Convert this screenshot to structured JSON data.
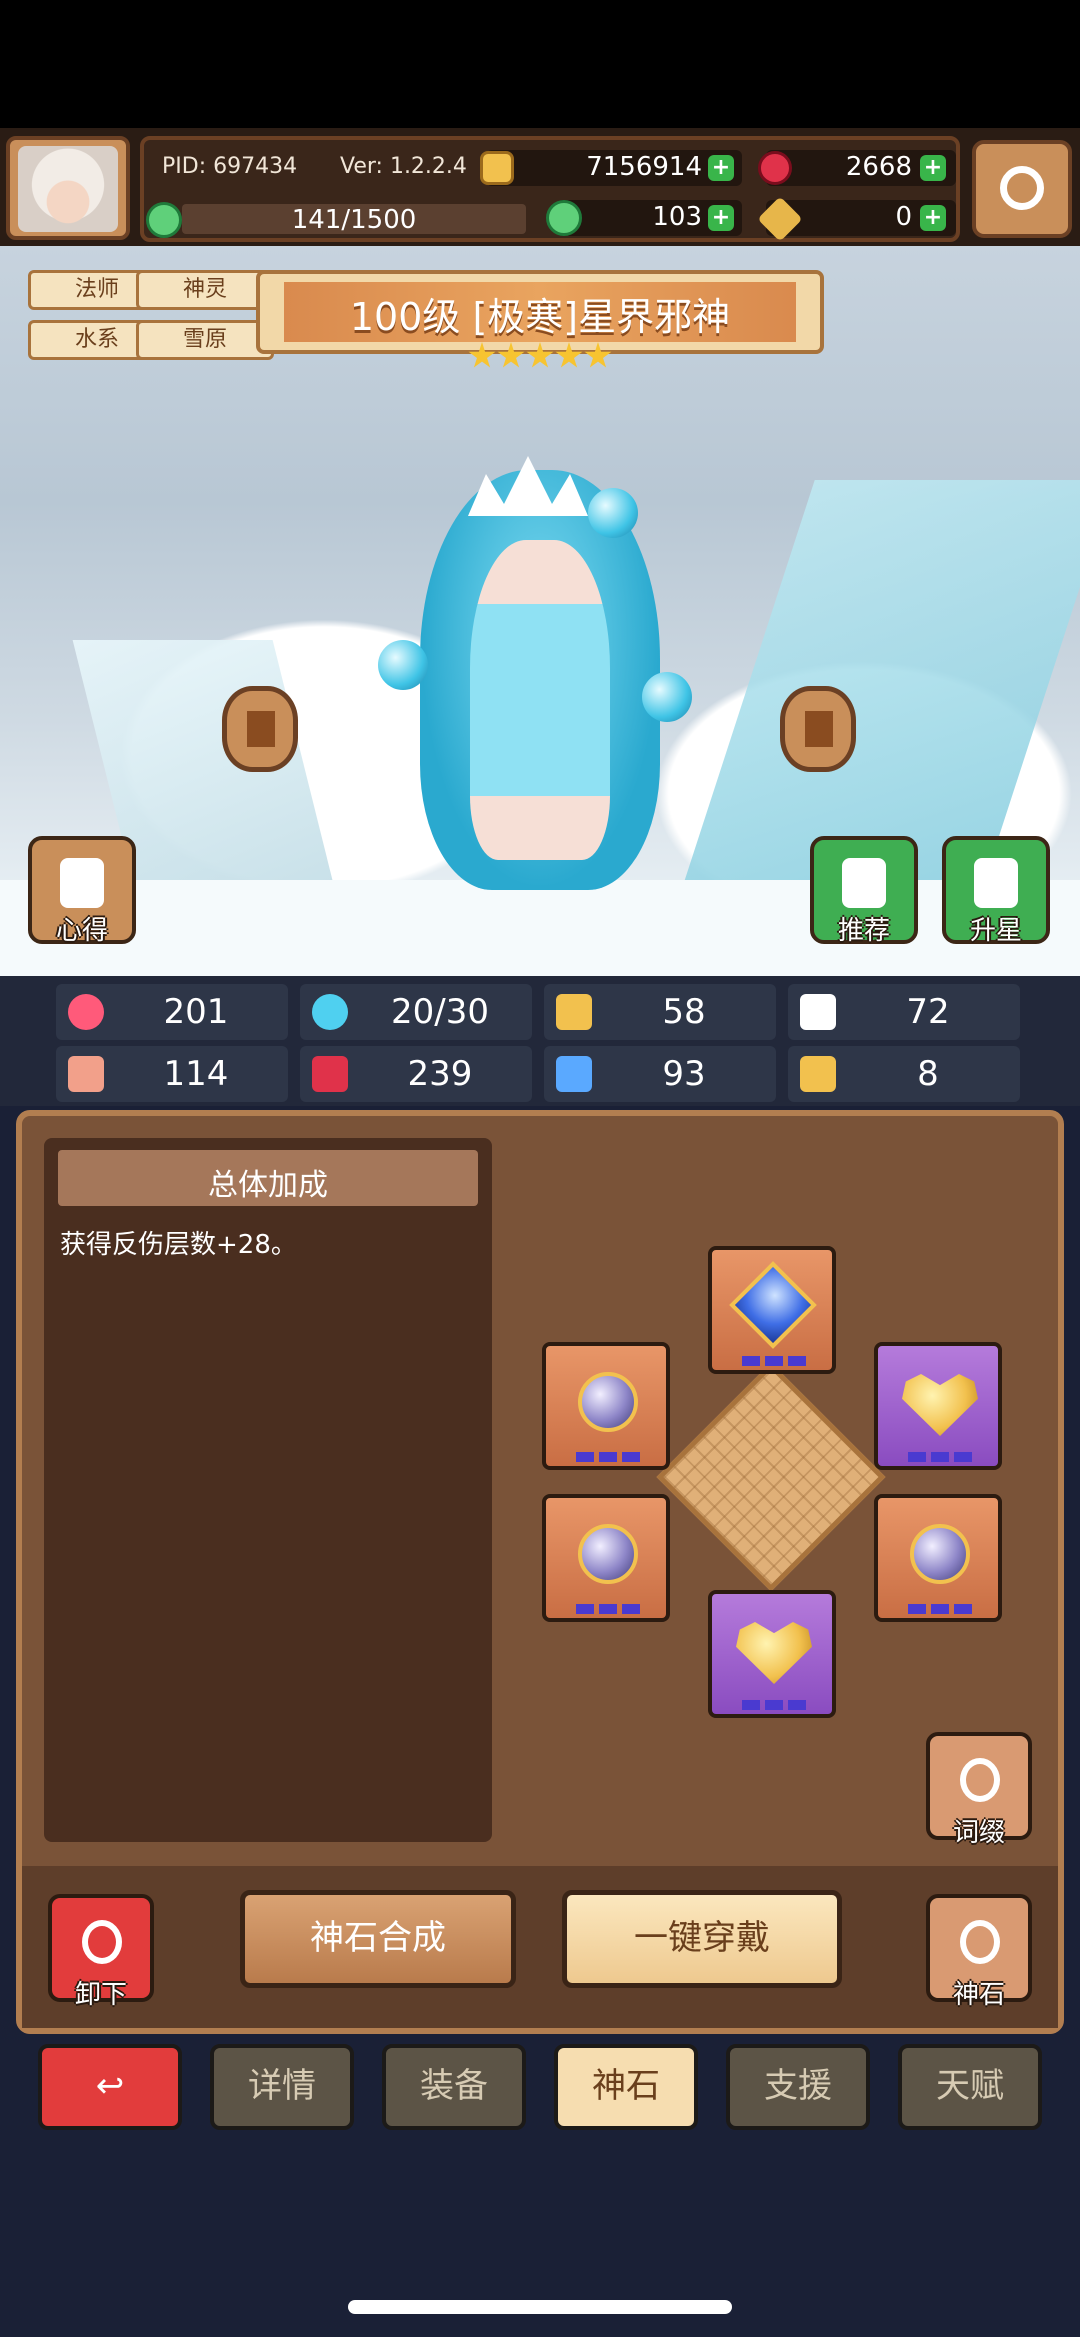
{
  "header": {
    "pid": "PID: 697434",
    "version": "Ver: 1.2.2.4",
    "gold": "7156914",
    "gems": "2668",
    "stamina": "141/1500",
    "clover": "103",
    "tokens": "0"
  },
  "hero": {
    "tags": [
      "法师",
      "神灵",
      "水系",
      "雪原"
    ],
    "title": "100级 [极寒]星界邪神",
    "stars": 5
  },
  "scene_buttons": {
    "insight": "心得",
    "recommend": "推荐",
    "star_up": "升星"
  },
  "stats": [
    {
      "icon": "heart-icon",
      "value": "201"
    },
    {
      "icon": "water-drop-icon",
      "value": "20/30"
    },
    {
      "icon": "shield-icon",
      "value": "58"
    },
    {
      "icon": "wing-icon",
      "value": "72"
    },
    {
      "icon": "fist-icon",
      "value": "114"
    },
    {
      "icon": "book-icon",
      "value": "239"
    },
    {
      "icon": "boot-icon",
      "value": "93"
    },
    {
      "icon": "horseshoe-icon",
      "value": "8"
    }
  ],
  "panel": {
    "header": "总体加成",
    "description": "获得反伤层数+28。",
    "affix_label": "词缀",
    "unequip_label": "卸下",
    "synth_label": "神石合成",
    "equip_all_label": "一键穿戴",
    "godstone_label": "神石"
  },
  "tabs": [
    "详情",
    "装备",
    "神石",
    "支援",
    "天赋"
  ],
  "colors": {
    "panel": "#7a5338",
    "accent_green": "#39b54a",
    "back_red": "#e23c3c",
    "active_tab": "#f6ddb0"
  }
}
